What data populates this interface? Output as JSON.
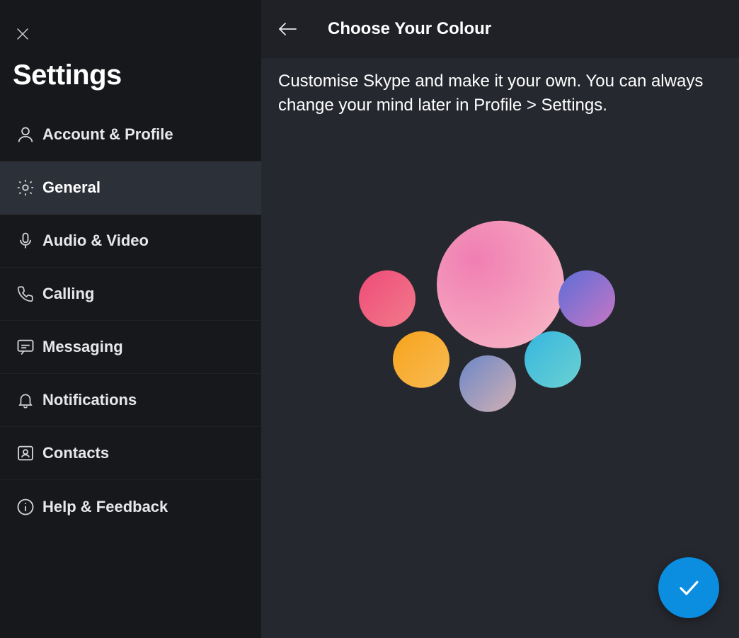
{
  "sidebar": {
    "title": "Settings",
    "items": [
      {
        "label": "Account & Profile",
        "icon": "account-icon"
      },
      {
        "label": "General",
        "icon": "gear-icon",
        "active": true
      },
      {
        "label": "Audio & Video",
        "icon": "microphone-icon"
      },
      {
        "label": "Calling",
        "icon": "phone-icon"
      },
      {
        "label": "Messaging",
        "icon": "chat-icon"
      },
      {
        "label": "Notifications",
        "icon": "bell-icon"
      },
      {
        "label": "Contacts",
        "icon": "contacts-icon"
      },
      {
        "label": "Help & Feedback",
        "icon": "info-icon"
      }
    ]
  },
  "main": {
    "header_title": "Choose Your Colour",
    "description": "Customise Skype and make it your own. You can always change your mind later in Profile > Settings.",
    "colour_options": [
      {
        "name": "pink",
        "selected": true
      },
      {
        "name": "red",
        "selected": false
      },
      {
        "name": "purple",
        "selected": false
      },
      {
        "name": "orange",
        "selected": false
      },
      {
        "name": "teal",
        "selected": false
      },
      {
        "name": "slate",
        "selected": false
      }
    ],
    "colors": {
      "accent": "#0b8ee0"
    }
  }
}
